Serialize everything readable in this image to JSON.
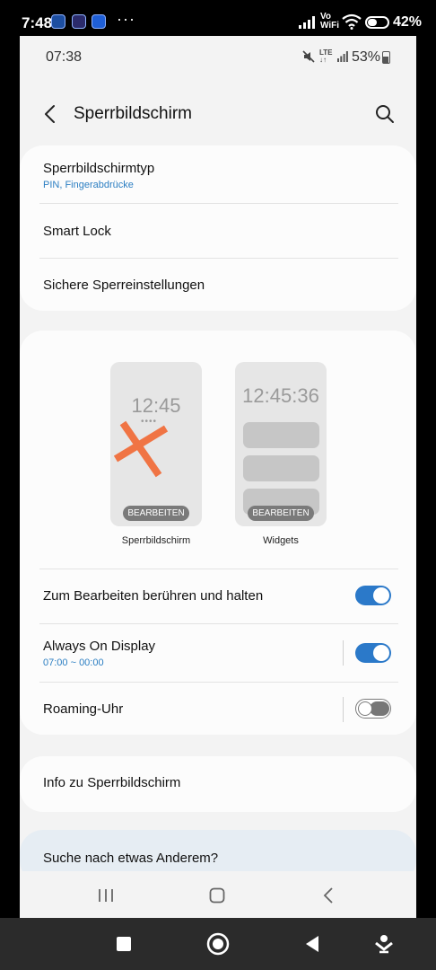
{
  "host_status": {
    "time": "7:48",
    "dots": "···",
    "vo_wifi_top": "Vo",
    "vo_wifi_bottom": "WiFi",
    "battery_pct": "42%"
  },
  "status": {
    "time": "07:38",
    "lte": "LTE",
    "battery_pct": "53%"
  },
  "header": {
    "title": "Sperrbildschirm"
  },
  "security": {
    "items": [
      {
        "label": "Sperrbildschirmtyp",
        "sub": "PIN, Fingerabdrücke"
      },
      {
        "label": "Smart Lock"
      },
      {
        "label": "Sichere Sperreinstellungen"
      }
    ]
  },
  "previews": {
    "lock": {
      "clock": "12:45",
      "dots": "••••",
      "edit": "BEARBEITEN",
      "caption": "Sperrbildschirm"
    },
    "widgets": {
      "clock": "12:45:36",
      "edit": "BEARBEITEN",
      "caption": "Widgets"
    }
  },
  "settings": {
    "touch_hold": {
      "label": "Zum Bearbeiten berühren und halten",
      "enabled": true
    },
    "aod": {
      "label": "Always On Display",
      "sub": "07:00 ~ 00:00",
      "enabled": true
    },
    "roaming": {
      "label": "Roaming-Uhr",
      "enabled": false
    }
  },
  "info": {
    "label": "Info zu Sperrbildschirm"
  },
  "suggest": {
    "label": "Suche nach etwas Anderem?"
  },
  "colors": {
    "accent": "#2b79c9",
    "cross": "#f07444",
    "background": "#f3f3f3",
    "card": "#fcfcfc"
  },
  "icons": {
    "back": "arrow-left-icon",
    "search": "search-icon",
    "recents": "recents-icon",
    "home": "home-icon",
    "nav_back": "chevron-left-icon"
  }
}
